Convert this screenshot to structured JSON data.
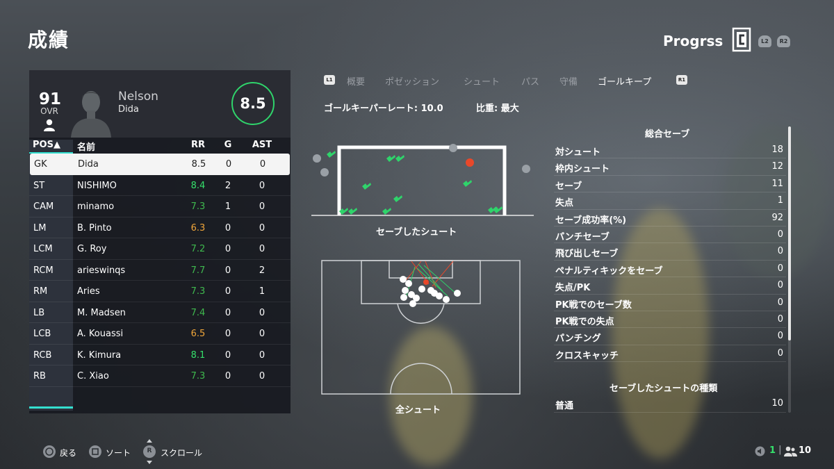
{
  "page": {
    "title": "成績"
  },
  "mode": {
    "title": "Progrss",
    "buttons": [
      "L2",
      "R2"
    ]
  },
  "player": {
    "ovr_value": "91",
    "ovr_label": "OVR",
    "first_name": "Nelson",
    "last_name": "Dida",
    "rating": "8.5"
  },
  "table": {
    "headers": [
      "POS▲",
      "名前",
      "RR",
      "G",
      "AST"
    ],
    "rows": [
      {
        "pos": "GK",
        "name": "Dida",
        "rr": "8.5",
        "g": "0",
        "ast": "0",
        "rr_color": "#1e1e1e"
      },
      {
        "pos": "ST",
        "name": "NISHIMO",
        "rr": "8.4",
        "g": "2",
        "ast": "0",
        "rr_color": "#35e06b"
      },
      {
        "pos": "CAM",
        "name": "minamo",
        "rr": "7.3",
        "g": "1",
        "ast": "0",
        "rr_color": "#3fb94e"
      },
      {
        "pos": "LM",
        "name": "B. Pinto",
        "rr": "6.3",
        "g": "0",
        "ast": "0",
        "rr_color": "#f0a63a"
      },
      {
        "pos": "LCM",
        "name": "G. Roy",
        "rr": "7.2",
        "g": "0",
        "ast": "0",
        "rr_color": "#3fb94e"
      },
      {
        "pos": "RCM",
        "name": "arieswinqs",
        "rr": "7.7",
        "g": "0",
        "ast": "2",
        "rr_color": "#3fb94e"
      },
      {
        "pos": "RM",
        "name": "Aries",
        "rr": "7.3",
        "g": "0",
        "ast": "1",
        "rr_color": "#3fb94e"
      },
      {
        "pos": "LB",
        "name": "M. Madsen",
        "rr": "7.4",
        "g": "0",
        "ast": "0",
        "rr_color": "#3fb94e"
      },
      {
        "pos": "LCB",
        "name": "A. Kouassi",
        "rr": "6.5",
        "g": "0",
        "ast": "0",
        "rr_color": "#f0a63a"
      },
      {
        "pos": "RCB",
        "name": "K. Kimura",
        "rr": "8.1",
        "g": "0",
        "ast": "0",
        "rr_color": "#35e06b"
      },
      {
        "pos": "RB",
        "name": "C. Xiao",
        "rr": "7.3",
        "g": "0",
        "ast": "0",
        "rr_color": "#3fb94e"
      }
    ]
  },
  "tabs": {
    "left_button": "L1",
    "right_button": "R1",
    "items": [
      "概要",
      "ポゼッション",
      "シュート",
      "パス",
      "守備",
      "ゴールキープ"
    ],
    "active_index": 5
  },
  "gk": {
    "rate": "ゴールキーパーレート: 10.0",
    "weight": "比重: 最大"
  },
  "charts": {
    "saved_caption": "セーブしたシュート",
    "all_caption": "全シュート"
  },
  "stats": {
    "title": "総合セーブ",
    "rows": [
      {
        "label": "対シュート",
        "value": "18"
      },
      {
        "label": "枠内シュート",
        "value": "12"
      },
      {
        "label": "セーブ",
        "value": "11"
      },
      {
        "label": "失点",
        "value": "1"
      },
      {
        "label": "セーブ成功率(%)",
        "value": "92"
      },
      {
        "label": "パンチセーブ",
        "value": "0"
      },
      {
        "label": "飛び出しセーブ",
        "value": "0"
      },
      {
        "label": "ペナルティキックをセーブ",
        "value": "0"
      },
      {
        "label": "失点/PK",
        "value": "0"
      },
      {
        "label": "PK戦でのセーブ数",
        "value": "0"
      },
      {
        "label": "PK戦での失点",
        "value": "0"
      },
      {
        "label": "パンチング",
        "value": "0"
      },
      {
        "label": "クロスキャッチ",
        "value": "0"
      }
    ],
    "types_title": "セーブしたシュートの種類",
    "types": [
      {
        "label": "普通",
        "value": "10"
      }
    ]
  },
  "footer": {
    "back": "戻る",
    "sort": "ソート",
    "scroll_button": "R",
    "scroll": "スクロール"
  },
  "counts": {
    "speaker": "1",
    "players": "10"
  },
  "colors": {
    "accent": "#34e0d0",
    "rating_ring": "#2fd46b",
    "save_mark": "#2fd46b",
    "goal_mark": "#e8482a"
  }
}
